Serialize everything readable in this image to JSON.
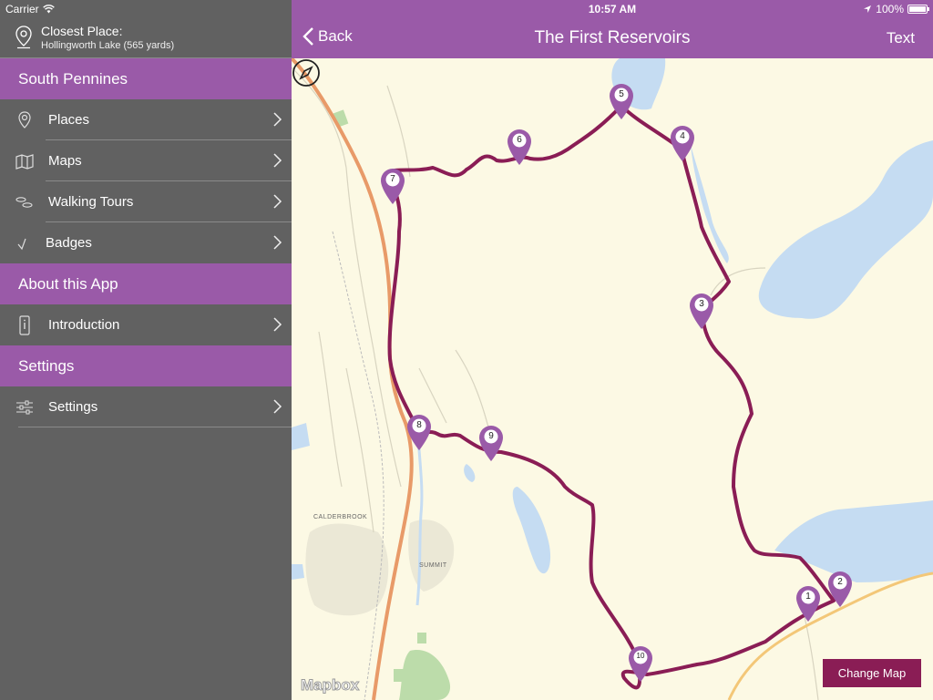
{
  "status": {
    "carrier": "Carrier",
    "time": "10:57 AM",
    "battery": "100%",
    "battery_level": 1.0
  },
  "closest": {
    "title": "Closest Place:",
    "subtitle": "Hollingworth Lake (565 yards)"
  },
  "sections": {
    "south_pennines": "South Pennines",
    "about": "About this App",
    "settings": "Settings"
  },
  "menu": {
    "places": "Places",
    "maps": "Maps",
    "walking_tours": "Walking Tours",
    "badges": "Badges",
    "introduction": "Introduction",
    "settings": "Settings"
  },
  "header": {
    "back": "Back",
    "title": "The First Reservoirs",
    "text_button": "Text"
  },
  "map": {
    "labels": {
      "calderbrook": "CALDERBROOK",
      "summit": "SUMMIT"
    },
    "markers": [
      "1",
      "2",
      "3",
      "4",
      "5",
      "6",
      "7",
      "8",
      "9",
      "10"
    ],
    "change_map": "Change Map",
    "attribution": "Mapbox",
    "colors": {
      "route": "#8a1d55",
      "marker": "#9a5aa8",
      "water": "#c5dcf2",
      "road": "#e89a68",
      "header": "#9a5aa8"
    }
  }
}
